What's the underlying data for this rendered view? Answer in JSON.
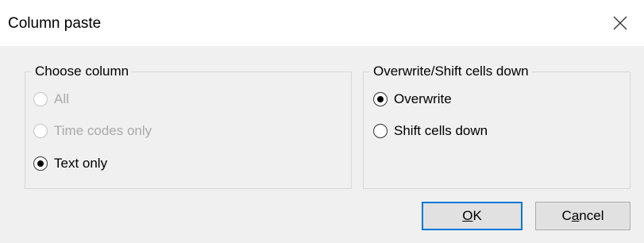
{
  "window": {
    "title": "Column paste",
    "close_icon": "close-icon"
  },
  "choose_column": {
    "legend": "Choose column",
    "options": [
      {
        "label": "All",
        "enabled": false,
        "selected": false
      },
      {
        "label": "Time codes only",
        "enabled": false,
        "selected": false
      },
      {
        "label": "Text only",
        "enabled": true,
        "selected": true
      }
    ]
  },
  "overwrite_shift": {
    "legend": "Overwrite/Shift cells down",
    "options": [
      {
        "label": "Overwrite",
        "enabled": true,
        "selected": true
      },
      {
        "label": "Shift cells down",
        "enabled": true,
        "selected": false
      }
    ]
  },
  "buttons": {
    "ok": {
      "mnemonic": "O",
      "rest": "K"
    },
    "cancel": {
      "prefix": "C",
      "mnemonic": "a",
      "rest": "ncel"
    }
  },
  "colors": {
    "dialog_bg": "#f0f0f0",
    "default_button_border": "#0078d7",
    "disabled_text": "#a9a9a9"
  }
}
